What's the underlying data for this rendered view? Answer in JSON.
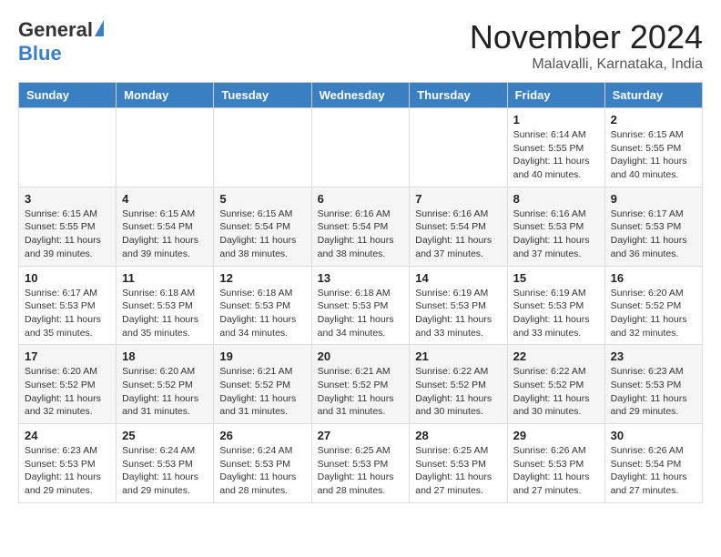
{
  "logo": {
    "general": "General",
    "blue": "Blue"
  },
  "title": "November 2024",
  "location": "Malavalli, Karnataka, India",
  "days_of_week": [
    "Sunday",
    "Monday",
    "Tuesday",
    "Wednesday",
    "Thursday",
    "Friday",
    "Saturday"
  ],
  "weeks": [
    [
      {
        "day": "",
        "info": ""
      },
      {
        "day": "",
        "info": ""
      },
      {
        "day": "",
        "info": ""
      },
      {
        "day": "",
        "info": ""
      },
      {
        "day": "",
        "info": ""
      },
      {
        "day": "1",
        "info": "Sunrise: 6:14 AM\nSunset: 5:55 PM\nDaylight: 11 hours\nand 40 minutes."
      },
      {
        "day": "2",
        "info": "Sunrise: 6:15 AM\nSunset: 5:55 PM\nDaylight: 11 hours\nand 40 minutes."
      }
    ],
    [
      {
        "day": "3",
        "info": "Sunrise: 6:15 AM\nSunset: 5:55 PM\nDaylight: 11 hours\nand 39 minutes."
      },
      {
        "day": "4",
        "info": "Sunrise: 6:15 AM\nSunset: 5:54 PM\nDaylight: 11 hours\nand 39 minutes."
      },
      {
        "day": "5",
        "info": "Sunrise: 6:15 AM\nSunset: 5:54 PM\nDaylight: 11 hours\nand 38 minutes."
      },
      {
        "day": "6",
        "info": "Sunrise: 6:16 AM\nSunset: 5:54 PM\nDaylight: 11 hours\nand 38 minutes."
      },
      {
        "day": "7",
        "info": "Sunrise: 6:16 AM\nSunset: 5:54 PM\nDaylight: 11 hours\nand 37 minutes."
      },
      {
        "day": "8",
        "info": "Sunrise: 6:16 AM\nSunset: 5:53 PM\nDaylight: 11 hours\nand 37 minutes."
      },
      {
        "day": "9",
        "info": "Sunrise: 6:17 AM\nSunset: 5:53 PM\nDaylight: 11 hours\nand 36 minutes."
      }
    ],
    [
      {
        "day": "10",
        "info": "Sunrise: 6:17 AM\nSunset: 5:53 PM\nDaylight: 11 hours\nand 35 minutes."
      },
      {
        "day": "11",
        "info": "Sunrise: 6:18 AM\nSunset: 5:53 PM\nDaylight: 11 hours\nand 35 minutes."
      },
      {
        "day": "12",
        "info": "Sunrise: 6:18 AM\nSunset: 5:53 PM\nDaylight: 11 hours\nand 34 minutes."
      },
      {
        "day": "13",
        "info": "Sunrise: 6:18 AM\nSunset: 5:53 PM\nDaylight: 11 hours\nand 34 minutes."
      },
      {
        "day": "14",
        "info": "Sunrise: 6:19 AM\nSunset: 5:53 PM\nDaylight: 11 hours\nand 33 minutes."
      },
      {
        "day": "15",
        "info": "Sunrise: 6:19 AM\nSunset: 5:53 PM\nDaylight: 11 hours\nand 33 minutes."
      },
      {
        "day": "16",
        "info": "Sunrise: 6:20 AM\nSunset: 5:52 PM\nDaylight: 11 hours\nand 32 minutes."
      }
    ],
    [
      {
        "day": "17",
        "info": "Sunrise: 6:20 AM\nSunset: 5:52 PM\nDaylight: 11 hours\nand 32 minutes."
      },
      {
        "day": "18",
        "info": "Sunrise: 6:20 AM\nSunset: 5:52 PM\nDaylight: 11 hours\nand 31 minutes."
      },
      {
        "day": "19",
        "info": "Sunrise: 6:21 AM\nSunset: 5:52 PM\nDaylight: 11 hours\nand 31 minutes."
      },
      {
        "day": "20",
        "info": "Sunrise: 6:21 AM\nSunset: 5:52 PM\nDaylight: 11 hours\nand 31 minutes."
      },
      {
        "day": "21",
        "info": "Sunrise: 6:22 AM\nSunset: 5:52 PM\nDaylight: 11 hours\nand 30 minutes."
      },
      {
        "day": "22",
        "info": "Sunrise: 6:22 AM\nSunset: 5:52 PM\nDaylight: 11 hours\nand 30 minutes."
      },
      {
        "day": "23",
        "info": "Sunrise: 6:23 AM\nSunset: 5:53 PM\nDaylight: 11 hours\nand 29 minutes."
      }
    ],
    [
      {
        "day": "24",
        "info": "Sunrise: 6:23 AM\nSunset: 5:53 PM\nDaylight: 11 hours\nand 29 minutes."
      },
      {
        "day": "25",
        "info": "Sunrise: 6:24 AM\nSunset: 5:53 PM\nDaylight: 11 hours\nand 29 minutes."
      },
      {
        "day": "26",
        "info": "Sunrise: 6:24 AM\nSunset: 5:53 PM\nDaylight: 11 hours\nand 28 minutes."
      },
      {
        "day": "27",
        "info": "Sunrise: 6:25 AM\nSunset: 5:53 PM\nDaylight: 11 hours\nand 28 minutes."
      },
      {
        "day": "28",
        "info": "Sunrise: 6:25 AM\nSunset: 5:53 PM\nDaylight: 11 hours\nand 27 minutes."
      },
      {
        "day": "29",
        "info": "Sunrise: 6:26 AM\nSunset: 5:53 PM\nDaylight: 11 hours\nand 27 minutes."
      },
      {
        "day": "30",
        "info": "Sunrise: 6:26 AM\nSunset: 5:54 PM\nDaylight: 11 hours\nand 27 minutes."
      }
    ]
  ]
}
